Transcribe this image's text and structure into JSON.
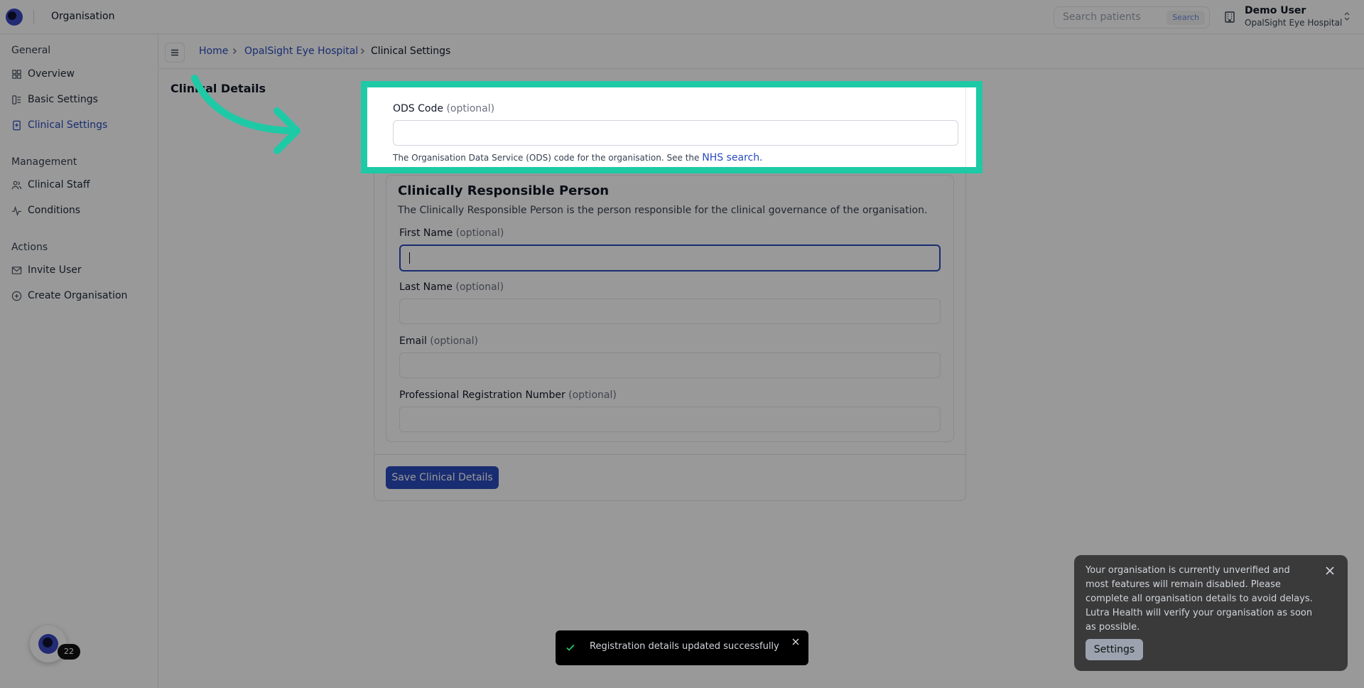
{
  "topbar": {
    "title": "Organisation",
    "search_placeholder": "Search patients",
    "search_button": "Search",
    "user_name": "Demo User",
    "user_org": "OpalSight Eye Hospital"
  },
  "sidebar": {
    "sections": [
      {
        "title": "General",
        "items": [
          "Overview",
          "Basic Settings",
          "Clinical Settings"
        ]
      },
      {
        "title": "Management",
        "items": [
          "Clinical Staff",
          "Conditions"
        ]
      },
      {
        "title": "Actions",
        "items": [
          "Invite User",
          "Create Organisation"
        ]
      }
    ],
    "active_item": "Clinical Settings",
    "badge_count": "22"
  },
  "breadcrumb": {
    "home": "Home",
    "org": "OpalSight Eye Hospital",
    "current": "Clinical Settings"
  },
  "page": {
    "heading": "Clinical Details",
    "ods": {
      "label": "ODS Code",
      "optional": "(optional)",
      "value": "",
      "help": "The Organisation Data Service (ODS) code for the organisation. See the",
      "help_link": "NHS search."
    },
    "crp": {
      "title": "Clinically Responsible Person",
      "description": "The Clinically Responsible Person is the person responsible for the clinical governance of the organisation.",
      "fields": [
        {
          "label": "First Name",
          "optional": "(optional)",
          "value": ""
        },
        {
          "label": "Last Name",
          "optional": "(optional)",
          "value": ""
        },
        {
          "label": "Email",
          "optional": "(optional)",
          "value": ""
        },
        {
          "label": "Professional Registration Number",
          "optional": "(optional)",
          "value": ""
        }
      ]
    },
    "save_button": "Save Clinical Details"
  },
  "notice": {
    "text": "Your organisation is currently unverified and most features will remain disabled. Please complete all organisation details to avoid delays. Lutra Health will verify your organisation as soon as possible.",
    "button": "Settings"
  },
  "toast": {
    "text": "Registration details updated successfully"
  },
  "colors": {
    "accent": "#2b4bbf",
    "highlight": "#1ec9a6",
    "overlay": "rgba(0,0,0,0.40)"
  }
}
